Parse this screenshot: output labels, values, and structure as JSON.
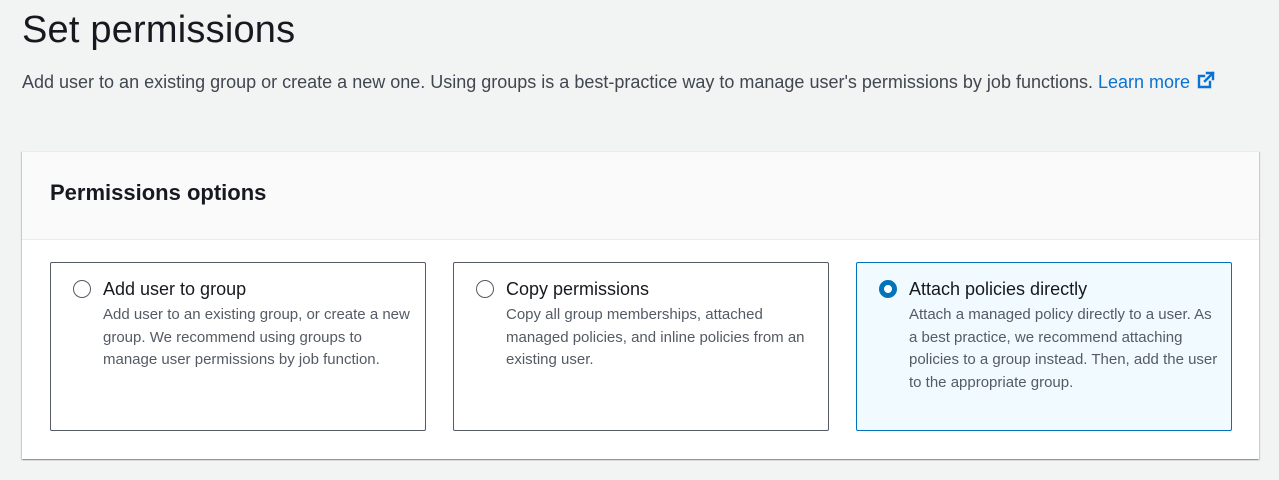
{
  "header": {
    "title": "Set permissions",
    "description": "Add user to an existing group or create a new one. Using groups is a best-practice way to manage user's permissions by job functions.",
    "learn_more_label": "Learn more",
    "learn_more_icon": "external-link-icon"
  },
  "permissions_panel": {
    "title": "Permissions options",
    "options": [
      {
        "label": "Add user to group",
        "description": "Add user to an existing group, or create a new group. We recommend using groups to manage user permissions by job function.",
        "selected": false
      },
      {
        "label": "Copy permissions",
        "description": "Copy all group memberships, attached managed policies, and inline policies from an existing user.",
        "selected": false
      },
      {
        "label": "Attach policies directly",
        "description": "Attach a managed policy directly to a user. As a best practice, we recommend attaching policies to a group instead. Then, add the user to the appropriate group.",
        "selected": true
      }
    ]
  },
  "colors": {
    "link": "#0972d3",
    "selected_border": "#0073bb",
    "selected_background": "#f1faff",
    "page_background": "#f2f3f3"
  }
}
